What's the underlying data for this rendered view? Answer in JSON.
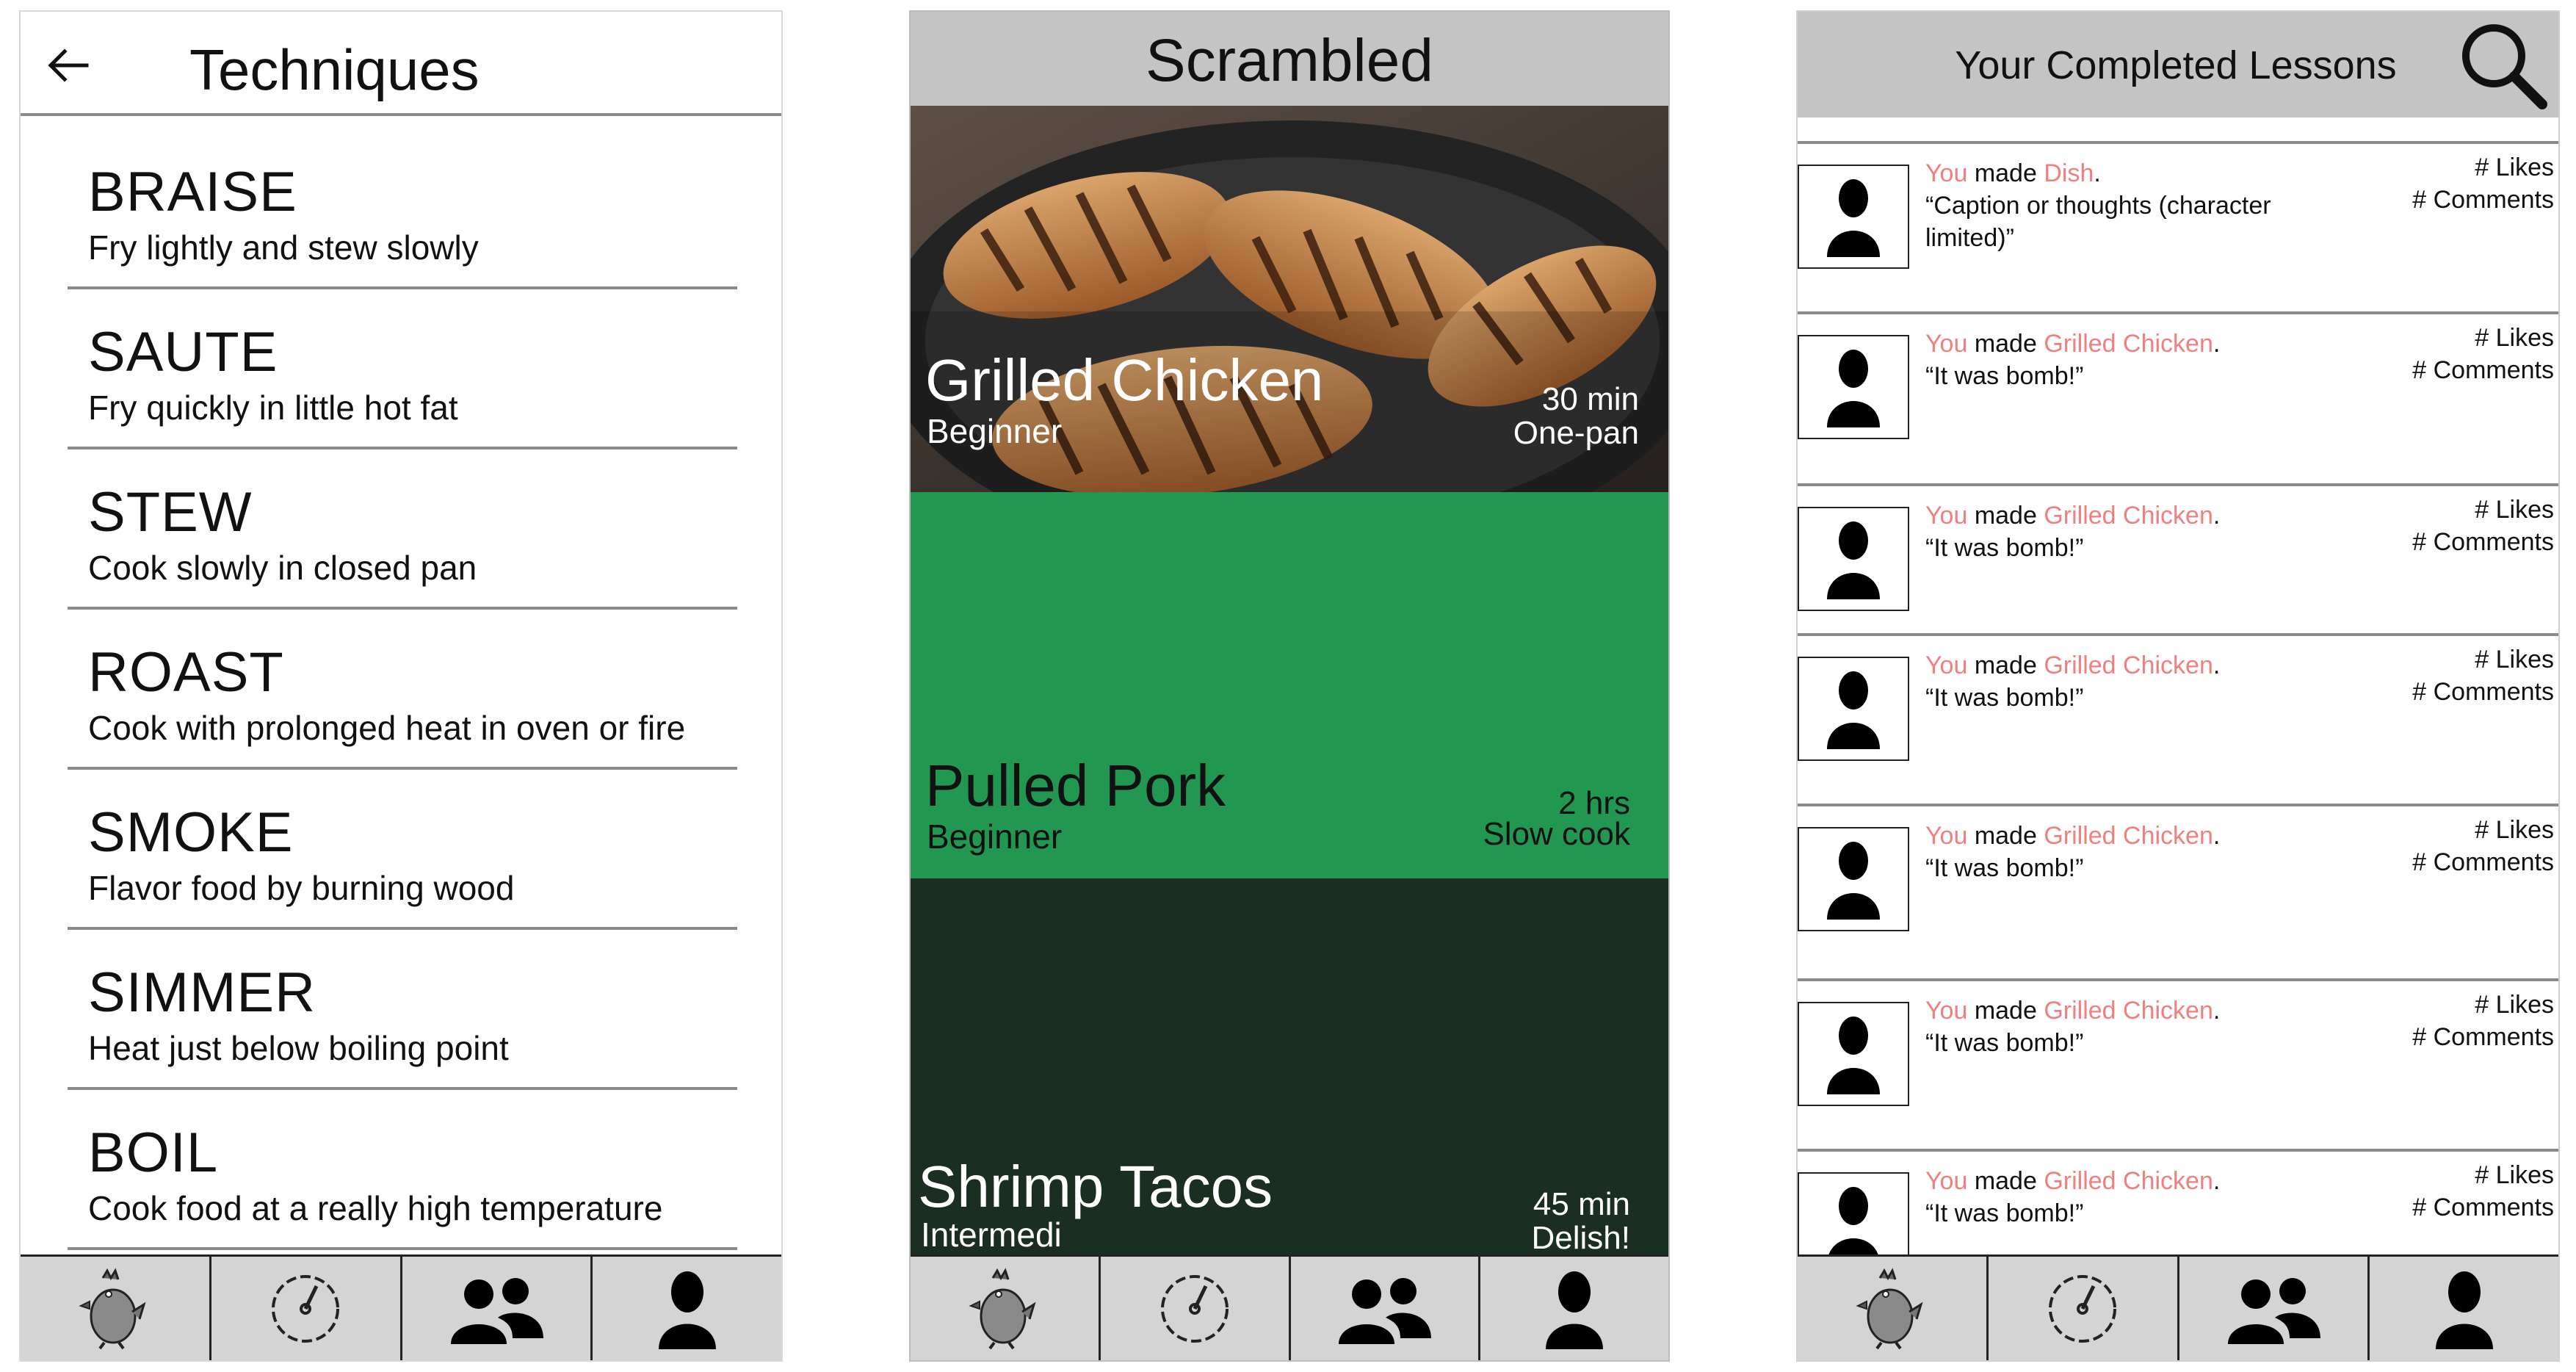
{
  "techniques": {
    "title": "Techniques",
    "items": [
      {
        "name": "BRAISE",
        "desc": "Fry lightly and stew slowly"
      },
      {
        "name": "SAUTE",
        "desc": "Fry quickly in little hot fat"
      },
      {
        "name": "STEW",
        "desc": "Cook slowly in closed pan"
      },
      {
        "name": "ROAST",
        "desc": "Cook with prolonged heat in oven or fire"
      },
      {
        "name": "SMOKE",
        "desc": "Flavor food by burning wood"
      },
      {
        "name": "SIMMER",
        "desc": "Heat just below boiling point"
      },
      {
        "name": "BOIL",
        "desc": "Cook food at a really high temperature"
      }
    ]
  },
  "scrambled": {
    "title": "Scrambled",
    "cards": [
      {
        "name": "Grilled Chicken",
        "level": "Beginner",
        "time": "30 min",
        "tag": "One-pan",
        "color": "#7a5a3c"
      },
      {
        "name": "Pulled Pork",
        "level": "Beginner",
        "time": "2 hrs",
        "tag": "Slow cook",
        "color": "#229752"
      },
      {
        "name": "Shrimp Tacos",
        "level": "Intermedi",
        "time": "45 min",
        "tag": "Delish!",
        "color": "#1b2e22"
      }
    ]
  },
  "lessons": {
    "title": "Your Completed Lessons",
    "likes_label": "# Likes",
    "comments_label": "# Comments",
    "posts": [
      {
        "you": "You",
        "made": "made",
        "dish": "Dish",
        "period": ".",
        "caption": "“Caption or thoughts (character limited)”"
      },
      {
        "you": "You",
        "made": "made",
        "dish": "Grilled Chicken",
        "period": ".",
        "caption": "“It was bomb!”"
      },
      {
        "you": "You",
        "made": "made",
        "dish": "Grilled Chicken",
        "period": ".",
        "caption": "“It was bomb!”"
      },
      {
        "you": "You",
        "made": "made",
        "dish": "Grilled Chicken",
        "period": ".",
        "caption": "“It was bomb!”"
      },
      {
        "you": "You",
        "made": "made",
        "dish": "Grilled Chicken",
        "period": ".",
        "caption": "“It was bomb!”"
      },
      {
        "you": "You",
        "made": "made",
        "dish": "Grilled Chicken",
        "period": ".",
        "caption": "“It was bomb!”"
      },
      {
        "you": "You",
        "made": "made",
        "dish": "Grilled Chicken",
        "period": ".",
        "caption": "“It was bomb!”"
      }
    ]
  },
  "nav": {
    "icons": [
      "chicken-icon",
      "timer-icon",
      "friends-icon",
      "profile-icon"
    ]
  },
  "colors": {
    "header_gray": "#c4c4c4",
    "nav_gray": "#d4d4d4",
    "highlight": "#f07f7f",
    "pork_green": "#229752",
    "taco_dark": "#1b2e22"
  }
}
